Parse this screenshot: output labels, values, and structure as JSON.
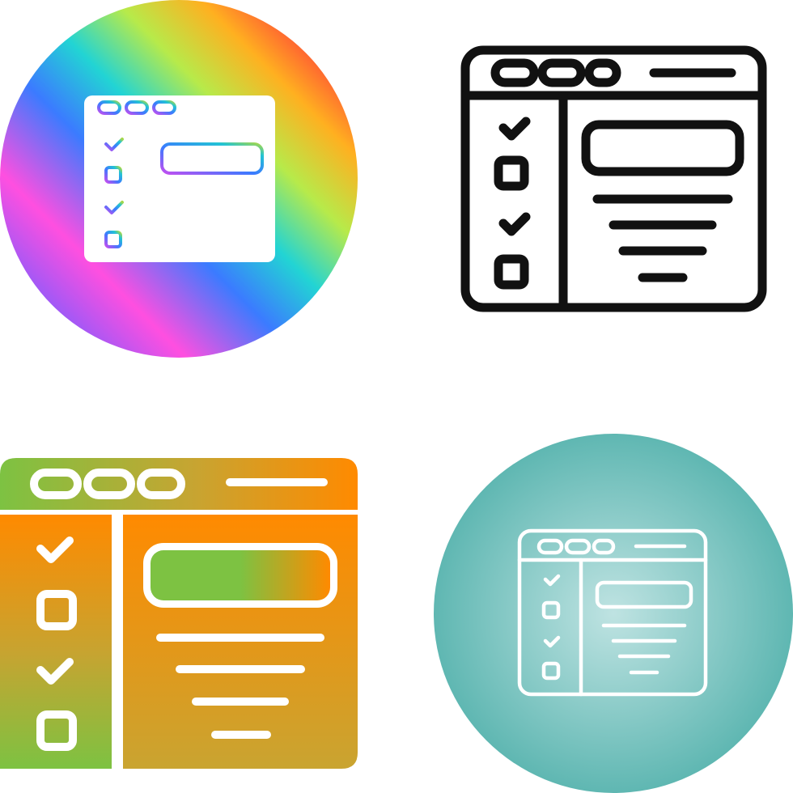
{
  "icon_set": {
    "icon_name": "browser-checklist-icon",
    "variants": [
      {
        "style": "gradient-circle",
        "background_gradient": [
          "#7a5cff",
          "#ff4fe0",
          "#3b7bff",
          "#22d4d4",
          "#b7ea4a",
          "#ffb020",
          "#ff3a3a"
        ],
        "glyph_color": "#ffffff",
        "glyph_gradient": [
          "#ff4fe0",
          "#3b7bff",
          "#22d4d4",
          "#b7ea4a"
        ]
      },
      {
        "style": "outline",
        "stroke_color": "#111111",
        "background_color": "#ffffff"
      },
      {
        "style": "gradient-glyph",
        "glyph_gradient": [
          "#7dc242",
          "#ff8a00",
          "#c9a431"
        ],
        "detail_color": "#ffffff"
      },
      {
        "style": "circle-outline",
        "circle_gradient": [
          "#bfe3e2",
          "#5fb7b2"
        ],
        "stroke_color": "#ffffff"
      }
    ]
  }
}
